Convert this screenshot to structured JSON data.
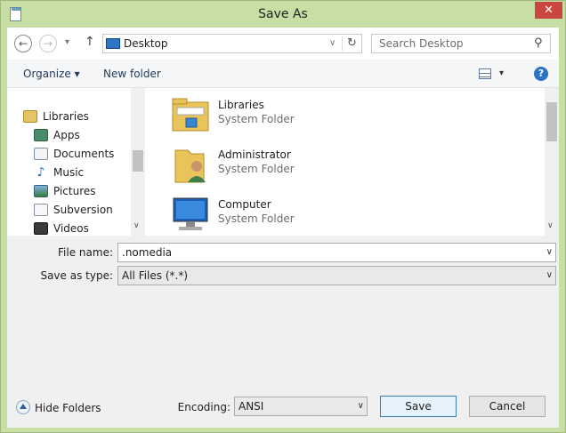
{
  "window": {
    "title": "Save As",
    "close_glyph": "✕"
  },
  "nav": {
    "back_glyph": "←",
    "forward_glyph": "→",
    "recent_glyph": "▾",
    "up_glyph": "↑",
    "address": "Desktop",
    "address_dropdown_glyph": "∨",
    "refresh_glyph": "↻",
    "search_placeholder": "Search Desktop",
    "search_glyph": "⚲"
  },
  "command_bar": {
    "organize": "Organize ▾",
    "new_folder": "New folder",
    "views_glyph": "▾",
    "help_glyph": "?"
  },
  "nav_pane": {
    "items": [
      {
        "label": "Libraries",
        "icon": "libraries-icon"
      },
      {
        "label": "Apps",
        "icon": "apps-icon"
      },
      {
        "label": "Documents",
        "icon": "documents-icon"
      },
      {
        "label": "Music",
        "icon": "music-icon"
      },
      {
        "label": "Pictures",
        "icon": "pictures-icon"
      },
      {
        "label": "Subversion",
        "icon": "subversion-icon"
      },
      {
        "label": "Videos",
        "icon": "videos-icon"
      }
    ],
    "scroll_down_glyph": "∨"
  },
  "files": [
    {
      "name": "Libraries",
      "type": "System Folder",
      "icon": "libraries-folder-icon"
    },
    {
      "name": "Administrator",
      "type": "System Folder",
      "icon": "user-folder-icon"
    },
    {
      "name": "Computer",
      "type": "System Folder",
      "icon": "computer-icon"
    }
  ],
  "form": {
    "filename_label": "File name:",
    "filename_value": ".nomedia",
    "savetype_label": "Save as type:",
    "savetype_value": "All Files  (*.*)",
    "dropdown_glyph": "∨",
    "hide_folders": "Hide Folders",
    "encoding_label": "Encoding:",
    "encoding_value": "ANSI",
    "save_button": "Save",
    "cancel_button": "Cancel"
  }
}
